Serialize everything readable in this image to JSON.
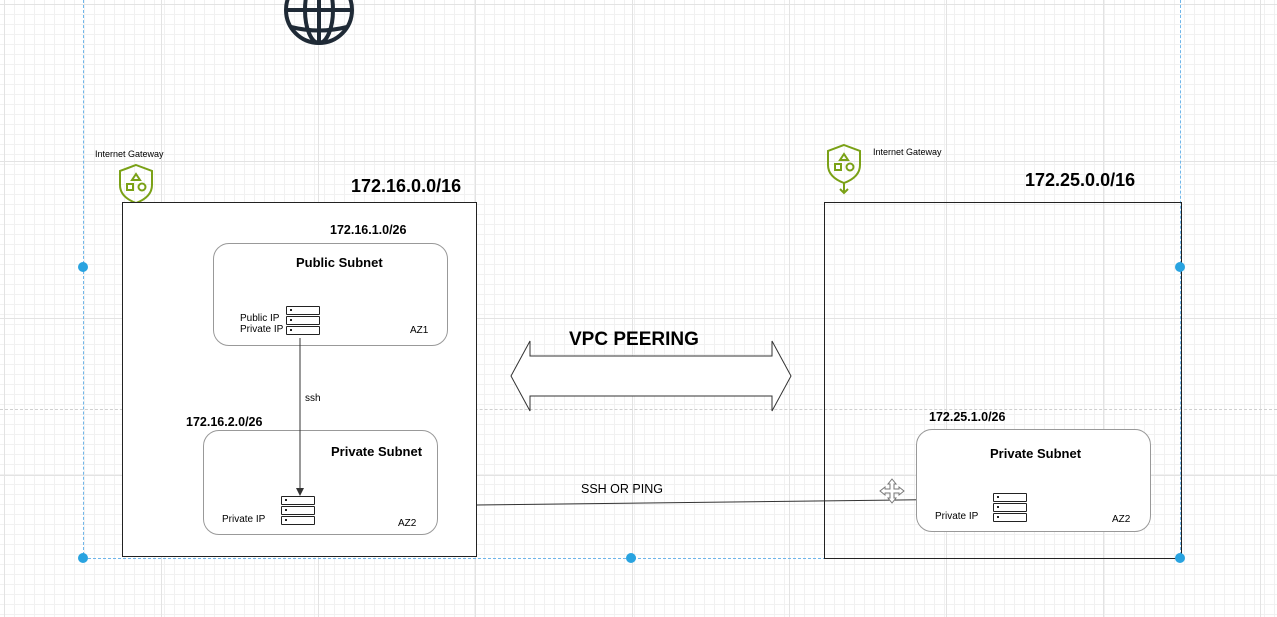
{
  "diagram": {
    "left_vpc": {
      "cidr": "172.16.0.0/16",
      "igw_label": "Internet Gateway",
      "public_subnet": {
        "cidr": "172.16.1.0/26",
        "title": "Public Subnet",
        "public_ip_label": "Public IP",
        "private_ip_label": "Private IP",
        "az": "AZ1"
      },
      "ssh_label": "ssh",
      "private_subnet": {
        "cidr": "172.16.2.0/26",
        "title": "Private Subnet",
        "private_ip_label": "Private IP",
        "az": "AZ2"
      }
    },
    "peering_label": "VPC PEERING",
    "connection_label": "SSH OR PING",
    "right_vpc": {
      "cidr": "172.25.0.0/16",
      "igw_label": "Internet Gateway",
      "private_subnet": {
        "cidr": "172.25.1.0/26",
        "title": "Private Subnet",
        "private_ip_label": "Private IP",
        "az": "AZ2"
      }
    },
    "colors": {
      "igw_icon": "#7aa116",
      "selection": "#29a3e0",
      "lines": "#222222"
    },
    "icons": [
      "globe-icon",
      "internet-gateway-icon",
      "server-icon",
      "move-cursor-icon"
    ]
  }
}
